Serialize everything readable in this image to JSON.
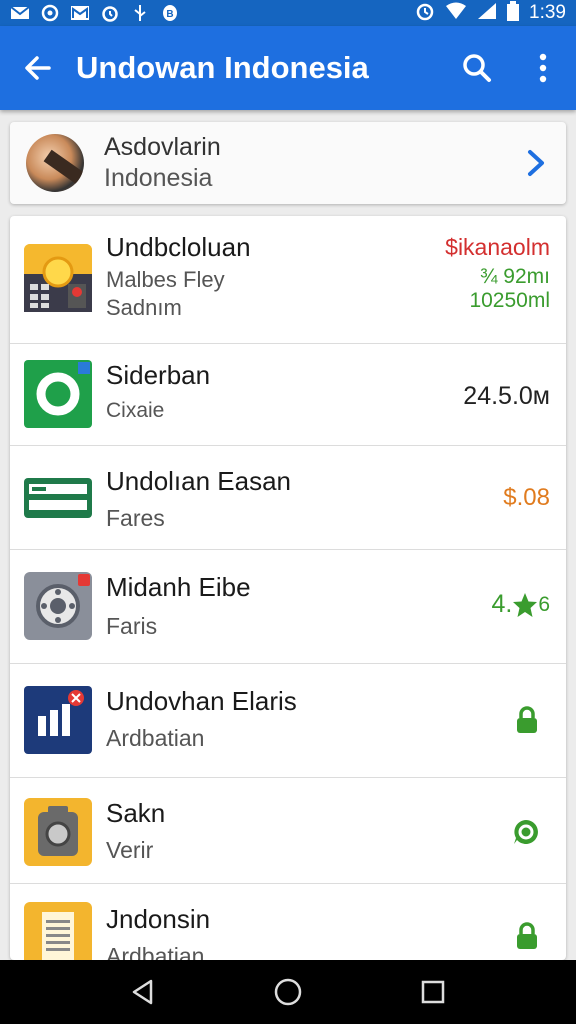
{
  "status_bar": {
    "time": "1:39",
    "left_icons": [
      "mail-icon",
      "sync-icon",
      "gmail-icon",
      "alarm-icon",
      "usb-icon",
      "shield-icon"
    ],
    "right_icons": [
      "alarm-icon",
      "wifi-icon",
      "signal-icon",
      "battery-icon"
    ]
  },
  "app_bar": {
    "title": "Undowan Indonesia",
    "color": "#1e6fe0"
  },
  "profile": {
    "line1": "Asdovlarin",
    "line2": "Indonesia"
  },
  "list": [
    {
      "title": "Undbcloluan",
      "subtitle1": "Malbes Fley",
      "subtitle2": "Sadnım",
      "right_top": "$ikanaolm",
      "right_mid": "¾ 92mı",
      "right_bottom": "10250ml",
      "icon": "calculator-app-icon"
    },
    {
      "title": "Siderban",
      "subtitle1": "Cixaie",
      "right_value": "24.5.0м",
      "icon": "green-ring-app-icon"
    },
    {
      "title": "Undolıan Easan",
      "subtitle1": "Fares",
      "right_value": "$.08",
      "icon": "list-app-icon"
    },
    {
      "title": "Midanh Eibe",
      "subtitle1": "Faris",
      "right_value": "4.",
      "right_suffix": "6",
      "icon": "settings-app-icon"
    },
    {
      "title": "Undovhan Elaris",
      "subtitle1": "Ardbatian",
      "icon": "chart-app-icon",
      "right_icon": "lock-icon"
    },
    {
      "title": "Sakn",
      "subtitle1": "Verir",
      "icon": "camera-app-icon",
      "right_icon": "chat-icon"
    },
    {
      "title": "Jndonsin",
      "subtitle1": "Ardbatian",
      "icon": "document-app-icon",
      "right_icon": "lock-icon"
    }
  ],
  "colors": {
    "red": "#d32f2f",
    "green": "#3a9c2e",
    "orange": "#e07b1e",
    "blue": "#1e6fe0"
  }
}
